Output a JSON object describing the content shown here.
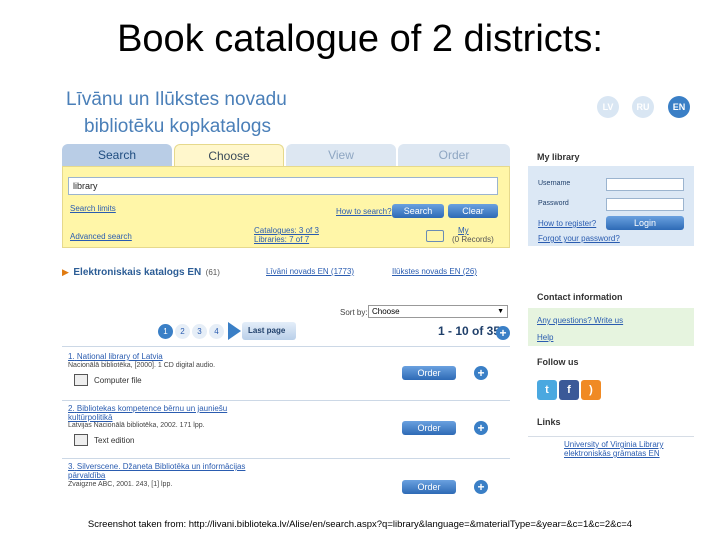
{
  "slide_title": "Book catalogue of 2 districts:",
  "site": {
    "title_line1": "Līvānu un Ilūkstes novadu",
    "title_line2": "bibliotēku kopkatalogs",
    "languages": [
      "LV",
      "RU",
      "EN"
    ],
    "active_language": "EN"
  },
  "tabs": [
    "Search",
    "Choose",
    "View",
    "Order"
  ],
  "search": {
    "value": "library",
    "search_limits": "Search limits",
    "how_to_search": "How to search?",
    "search_button": "Search",
    "clear_button": "Clear",
    "advanced_search": "Advanced search",
    "catalogues_label": "Catalogues: 3 of 3",
    "libraries_label": "Libraries: 7 of 7",
    "my_label": "My",
    "my_sub": "(0 Records)"
  },
  "catalog_row": {
    "name": "Elektroniskais katalogs EN",
    "count": "(61)",
    "col2": "Līvāni novads EN (1773)",
    "col3": "Ilūkstes novads EN (26)"
  },
  "results": {
    "pages": [
      "1",
      "2",
      "3",
      "4"
    ],
    "last_page": "Last page",
    "sort_by_label": "Sort by:",
    "sort_value": "Choose",
    "range": "1 - 10 of 35",
    "order_label": "Order",
    "items": [
      {
        "num": "1.",
        "title": "National library of Latvia",
        "meta": "Nacionālā bibliotēka, [2000]. 1 CD digital audio.",
        "type": "Computer file"
      },
      {
        "num": "2.",
        "title": "Bibliotekas kompetence bērnu un jauniešu kultūrpolitikā",
        "meta": "Latvijas Nacionālā bibliotēka, 2002. 171 lpp.",
        "type": "Text edition"
      },
      {
        "num": "3.",
        "title": "Silverscene. Džaneta Bibliotēka un informācijas pārvaldība",
        "meta": "Zvaigzne ABC, 2001. 243, [1] lpp.",
        "type": ""
      }
    ]
  },
  "sidebar": {
    "my_library": "My library",
    "username": "Username",
    "password": "Password",
    "how_to_register": "How to register?",
    "login": "Login",
    "forgot": "Forgot your password?",
    "contact_head": "Contact information",
    "any_questions": "Any questions? Write us",
    "help": "Help",
    "follow_head": "Follow us",
    "links_head": "Links",
    "link1": "University of Virginia Library",
    "link2": "elektroniskās grāmatas EN"
  },
  "colors": {
    "accent": "#3a7fc6",
    "panel_yellow": "#fff6a8",
    "panel_blue": "#dce8f5",
    "panel_green": "#e6f4df"
  },
  "footer": "Screenshot taken from: http://livani.biblioteka.lv/Alise/en/search.aspx?q=library&language=&materialType=&year=&c=1&c=2&c=4"
}
